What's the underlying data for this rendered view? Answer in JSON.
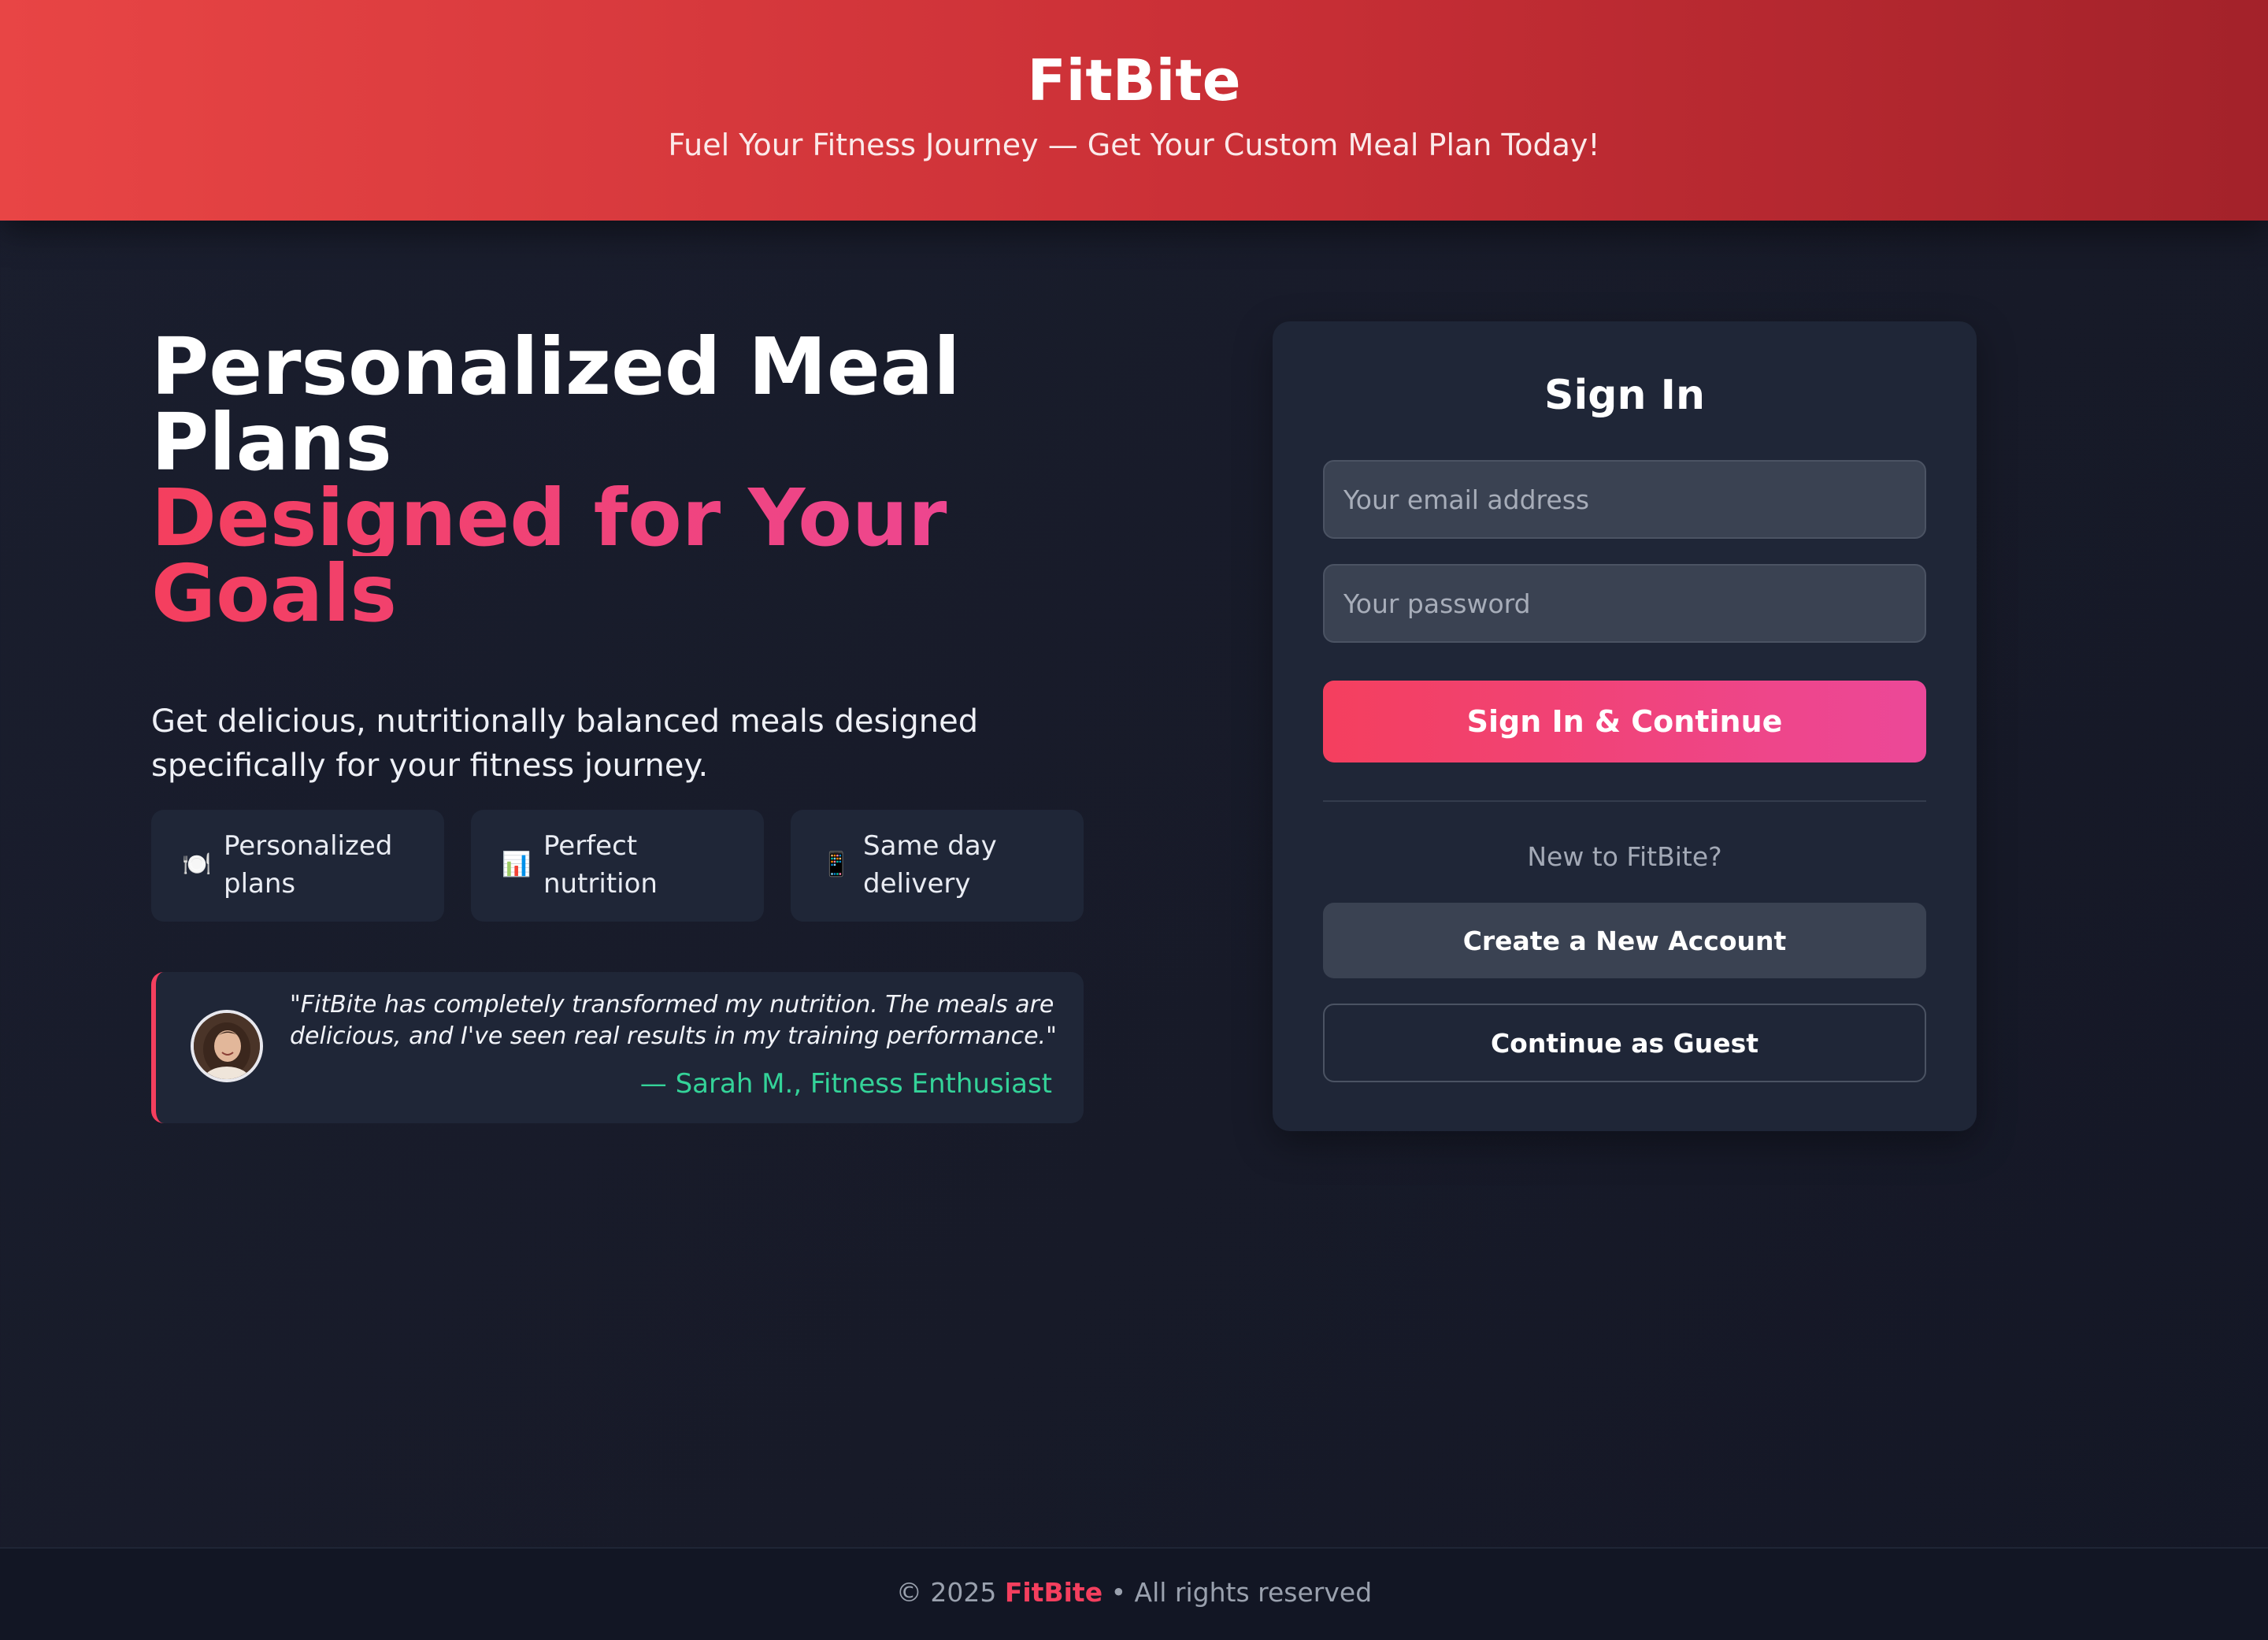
{
  "header": {
    "brand": "FitBite",
    "tagline": "Fuel Your Fitness Journey — Get Your Custom Meal Plan Today!"
  },
  "hero": {
    "title_line1": "Personalized Meal",
    "title_line2": "Plans",
    "title_accent_line1": "Designed for Your",
    "title_accent_line2": "Goals",
    "subtitle": "Get delicious, nutritionally balanced meals designed specifically for your fitness journey."
  },
  "features": [
    {
      "icon": "plate-icon",
      "glyph": "🍽️",
      "label": "Personalized plans"
    },
    {
      "icon": "bar-chart-icon",
      "glyph": "📊",
      "label": "Perfect nutrition"
    },
    {
      "icon": "phone-icon",
      "glyph": "📱",
      "label": "Same day delivery"
    }
  ],
  "testimonial": {
    "quote": "\"FitBite has completely transformed my nutrition. The meals are delicious, and I've seen real results in my training performance.\"",
    "author": "— Sarah M., Fitness Enthusiast"
  },
  "signin": {
    "title": "Sign In",
    "email_placeholder": "Your email address",
    "password_placeholder": "Your password",
    "primary_button": "Sign In & Continue",
    "new_prompt": "New to FitBite?",
    "create_button": "Create a New Account",
    "guest_button": "Continue as Guest"
  },
  "footer": {
    "copyright": "© 2025",
    "brand": "FitBite",
    "rights": "• All rights reserved"
  },
  "colors": {
    "accent_start": "#f43f5e",
    "accent_end": "#ec4899",
    "header_start": "#e84545",
    "header_end": "#a3222a",
    "quote_author": "#34d399",
    "background": "#1a1e2e",
    "card": "#1f2637"
  }
}
